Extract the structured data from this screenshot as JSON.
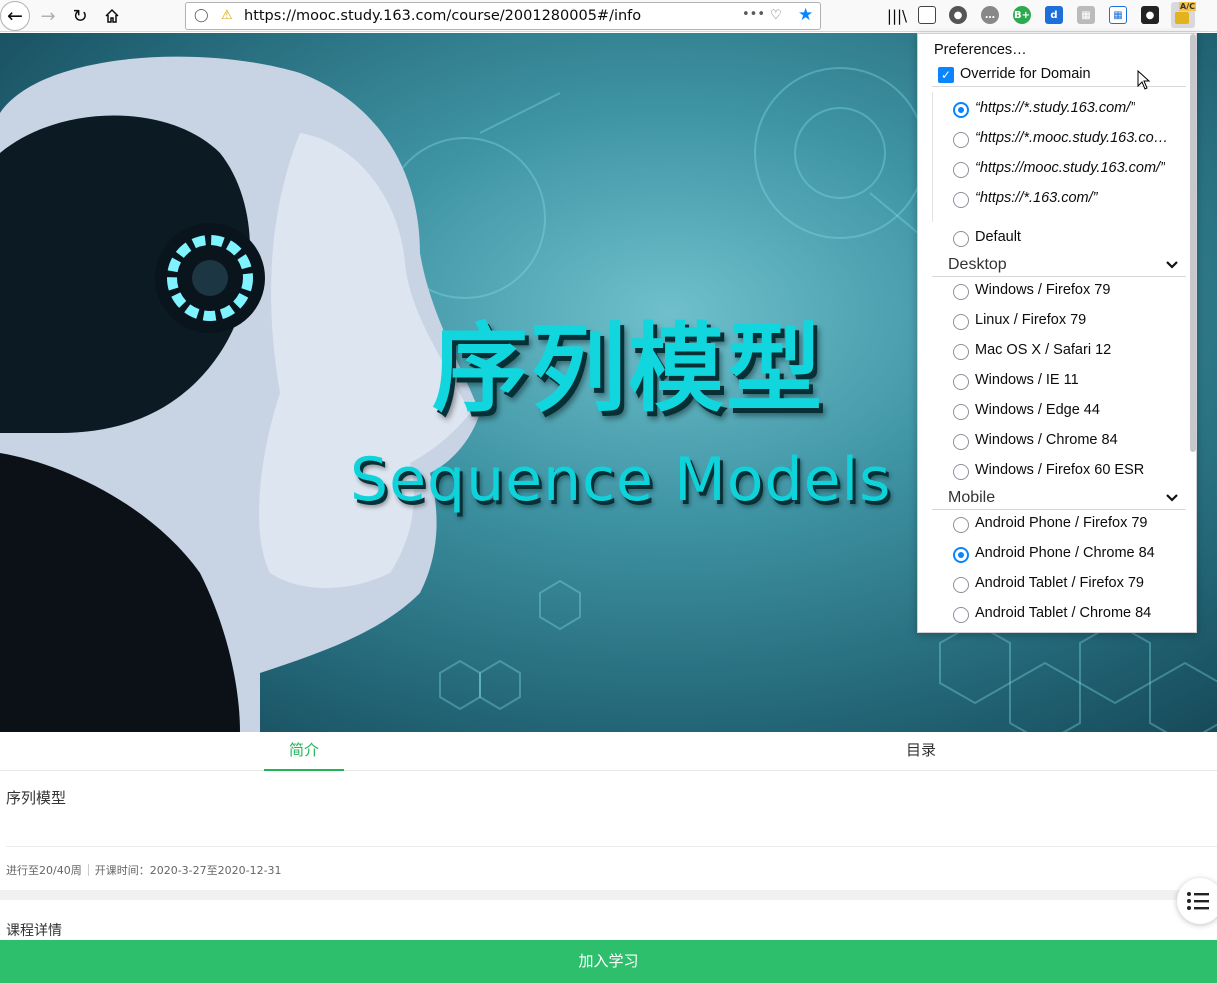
{
  "browser": {
    "url": "https://mooc.study.163.com/course/2001280005#/info",
    "ellipsis": "•••",
    "ext_badge": "A/C"
  },
  "hero": {
    "title": "序列模型",
    "subtitle": "Sequence Models"
  },
  "tabs": [
    {
      "label": "简介",
      "active": true
    },
    {
      "label": "目录",
      "active": false
    }
  ],
  "course": {
    "name": "序列模型",
    "progress": "进行至20/40周",
    "schedule": "开课时间：2020-3-27至2020-12-31",
    "section_title": "课程详情",
    "join_label": "加入学习"
  },
  "panel": {
    "preferences_label": "Preferences…",
    "override_label": "Override for Domain",
    "override_checked": true,
    "domains": [
      {
        "label": "“https://*.study.163.com/”",
        "selected": true
      },
      {
        "label": "“https://*.mooc.study.163.co…",
        "selected": false
      },
      {
        "label": "“https://mooc.study.163.com/”",
        "selected": false
      },
      {
        "label": "“https://*.163.com/”",
        "selected": false
      }
    ],
    "default_label": "Default",
    "desktop_label": "Desktop",
    "desktop_options": [
      "Windows / Firefox 79",
      "Linux / Firefox 79",
      "Mac OS X / Safari 12",
      "Windows / IE 11",
      "Windows / Edge 44",
      "Windows / Chrome 84",
      "Windows / Firefox 60 ESR"
    ],
    "mobile_label": "Mobile",
    "mobile_options": [
      {
        "label": "Android Phone / Firefox 79",
        "selected": false
      },
      {
        "label": "Android Phone / Chrome 84",
        "selected": true
      },
      {
        "label": "Android Tablet / Firefox 79",
        "selected": false
      },
      {
        "label": "Android Tablet / Chrome 84",
        "selected": false
      }
    ]
  },
  "colors": {
    "accent_green": "#21b559",
    "join_bar": "#2ebf6d",
    "radio_blue": "#0a84ff",
    "hero_text": "#11d6dd"
  }
}
